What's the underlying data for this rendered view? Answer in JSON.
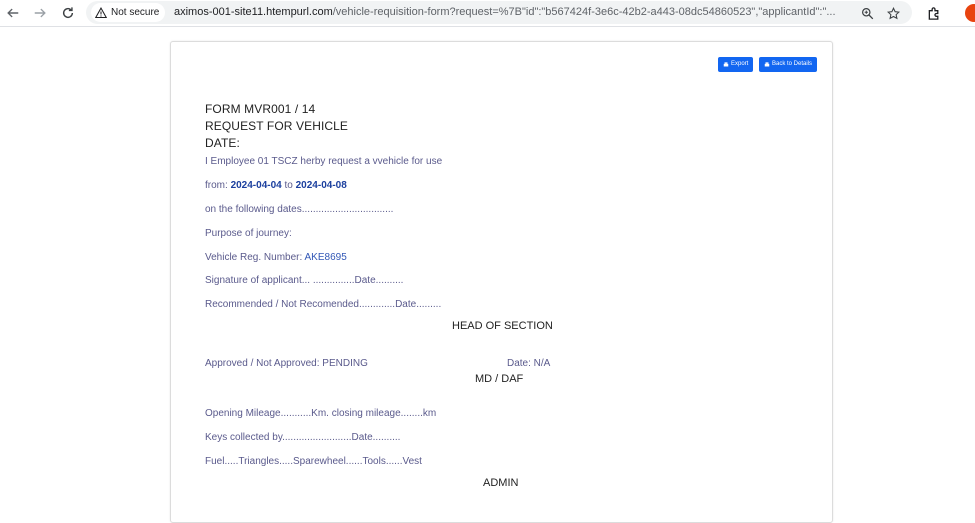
{
  "browser": {
    "security_label": "Not secure",
    "url_host": "aximos-001-site11.htempurl.com",
    "url_rest": "/vehicle-requisition-form?request=%7B\"id\":\"b567424f-3e6c-42b2-a443-08dc54860523\",\"applicantId\":\"..."
  },
  "toolbar": {
    "export_label": "Export",
    "back_label": "Back to Details"
  },
  "form": {
    "form_number": "FORM MVR001 / 14",
    "title": "REQUEST FOR VEHICLE",
    "date_label": "DATE:",
    "request_line": "I Employee 01 TSCZ herby request a vvehicle for use",
    "from_label": "from:",
    "from_date": "2024-04-04",
    "to_label": "to",
    "to_date": "2024-04-08",
    "following_dates": "on the following dates.................................",
    "purpose": "Purpose of journey:",
    "vehicle_reg_label": "Vehicle Reg. Number:",
    "vehicle_reg_value": "AKE8695",
    "signature_line": "Signature of applicant... ...............Date..........",
    "recommended_line": "Recommended / Not Recomended.............Date.........",
    "head_of_section": "HEAD OF SECTION",
    "approved_line": "Approved / Not Approved: PENDING",
    "approved_date": "Date: N/A",
    "md_daf": "MD / DAF",
    "mileage_line": "Opening Mileage...........Km. closing mileage........km",
    "keys_line": "Keys collected by.........................Date..........",
    "fuel_line": "Fuel.....Triangles.....Sparewheel......Tools......Vest",
    "admin": "ADMIN"
  }
}
